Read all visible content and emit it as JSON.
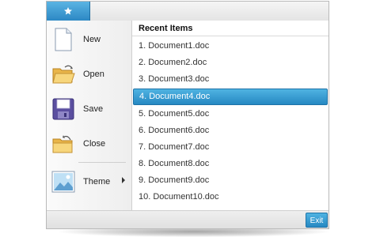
{
  "app_menu": {
    "tab_icon": "star-icon",
    "commands": [
      {
        "label": "New",
        "icon": "new-document-icon"
      },
      {
        "label": "Open",
        "icon": "open-folder-icon"
      },
      {
        "label": "Save",
        "icon": "save-floppy-icon"
      },
      {
        "label": "Close",
        "icon": "close-folder-icon"
      },
      {
        "label": "Theme",
        "icon": "theme-image-icon"
      }
    ]
  },
  "recent": {
    "title": "Recent Items",
    "items": [
      "1. Document1.doc",
      "2. Documen2.doc",
      "3. Document3.doc",
      "4. Document4.doc",
      "5. Document5.doc",
      "6. Document6.doc",
      "7. Document7.doc",
      "8. Document8.doc",
      "9. Document9.doc",
      "10. Document10.doc"
    ],
    "selected_index": 3
  },
  "footer": {
    "exit_label": "Exit"
  },
  "colors": {
    "accent": "#2c88c4",
    "accent_light": "#5bb4e3"
  }
}
